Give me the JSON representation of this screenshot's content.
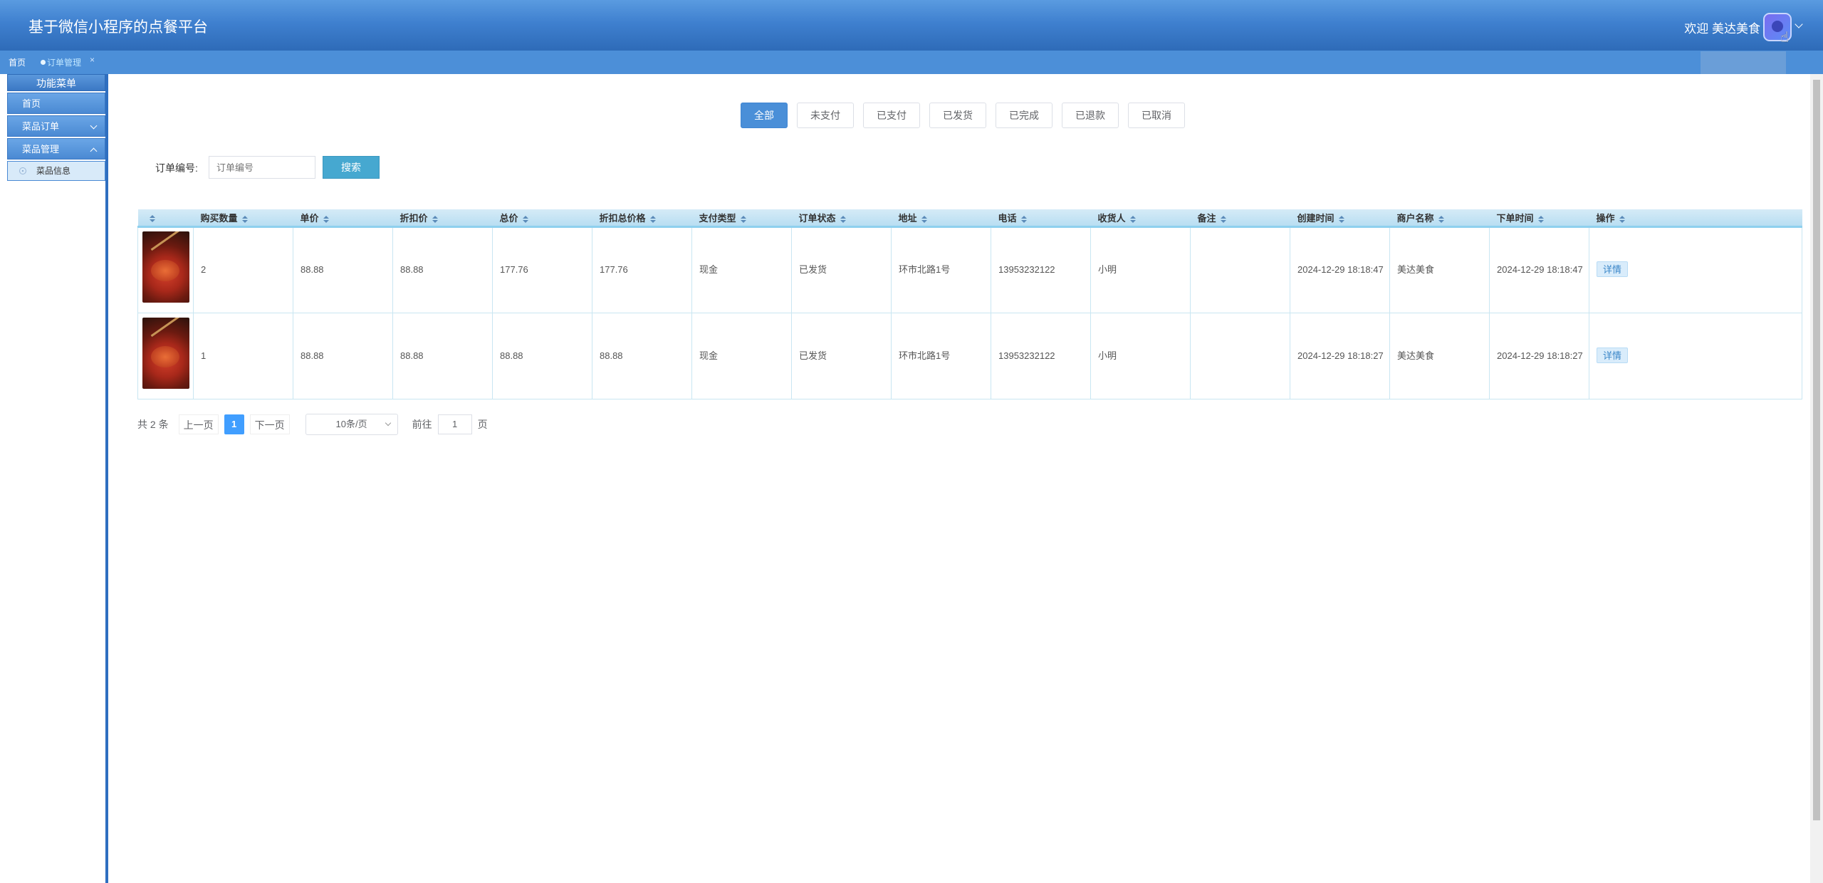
{
  "header": {
    "title": "基于微信小程序的点餐平台",
    "welcome": "欢迎 美达美食"
  },
  "tabs": {
    "home": "首页",
    "active": "订单管理",
    "close": "×"
  },
  "sidebar": {
    "title": "功能菜单",
    "items": [
      {
        "label": "首页"
      },
      {
        "label": "菜品订单"
      },
      {
        "label": "菜品管理"
      }
    ],
    "subitem": "菜品信息"
  },
  "filters": [
    "全部",
    "未支付",
    "已支付",
    "已发货",
    "已完成",
    "已退款",
    "已取消"
  ],
  "search": {
    "label": "订单编号:",
    "placeholder": "订单编号",
    "button": "搜索"
  },
  "table": {
    "headers": [
      "",
      "购买数量",
      "单价",
      "折扣价",
      "总价",
      "折扣总价格",
      "支付类型",
      "订单状态",
      "地址",
      "电话",
      "收货人",
      "备注",
      "创建时间",
      "商户名称",
      "下单时间",
      "操作"
    ],
    "rows": [
      {
        "qty": "2",
        "price": "88.88",
        "discount": "88.88",
        "total": "177.76",
        "discount_total": "177.76",
        "pay_type": "现金",
        "status": "已发货",
        "address": "环市北路1号",
        "phone": "13953232122",
        "receiver": "小明",
        "remark": "",
        "created": "2024-12-29 18:18:47",
        "merchant": "美达美食",
        "ordered": "2024-12-29 18:18:47",
        "action": "详情"
      },
      {
        "qty": "1",
        "price": "88.88",
        "discount": "88.88",
        "total": "88.88",
        "discount_total": "88.88",
        "pay_type": "现金",
        "status": "已发货",
        "address": "环市北路1号",
        "phone": "13953232122",
        "receiver": "小明",
        "remark": "",
        "created": "2024-12-29 18:18:27",
        "merchant": "美达美食",
        "ordered": "2024-12-29 18:18:27",
        "action": "详情"
      }
    ]
  },
  "pager": {
    "total": "共 2 条",
    "prev": "上一页",
    "current": "1",
    "next": "下一页",
    "page_size": "10条/页",
    "goto_label": "前往",
    "goto_value": "1",
    "goto_suffix": "页"
  }
}
